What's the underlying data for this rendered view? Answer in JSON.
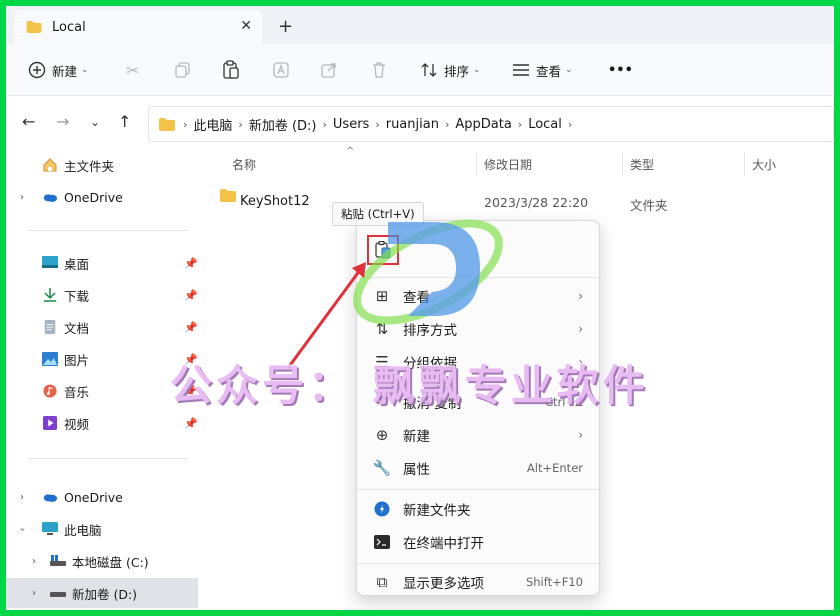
{
  "tab": {
    "title": "Local",
    "close": "✕",
    "new_tab": "+"
  },
  "toolbar": {
    "new_label": "新建",
    "sort_label": "排序",
    "view_label": "查看",
    "more": "•••"
  },
  "address": {
    "crumbs": [
      "此电脑",
      "新加卷 (D:)",
      "Users",
      "ruanjian",
      "AppData",
      "Local"
    ]
  },
  "sidebar": {
    "items": [
      {
        "label": "主文件夹"
      },
      {
        "label": "OneDrive"
      },
      {
        "label": "桌面"
      },
      {
        "label": "下载"
      },
      {
        "label": "文档"
      },
      {
        "label": "图片"
      },
      {
        "label": "音乐"
      },
      {
        "label": "视频"
      },
      {
        "label": "OneDrive"
      },
      {
        "label": "此电脑"
      },
      {
        "label": "本地磁盘 (C:)"
      },
      {
        "label": "新加卷 (D:)"
      }
    ]
  },
  "columns": {
    "name": "名称",
    "modified": "修改日期",
    "type": "类型",
    "size": "大小"
  },
  "files": [
    {
      "name": "KeyShot12",
      "modified": "2023/3/28 22:20",
      "type": "文件夹"
    }
  ],
  "tooltip": {
    "text": "粘贴 (Ctrl+V)"
  },
  "context_menu": {
    "items": [
      {
        "label": "查看",
        "icon": "grid-icon"
      },
      {
        "label": "排序方式",
        "icon": "sort-icon"
      },
      {
        "label": "分组依据",
        "icon": "group-icon"
      },
      {
        "label": "撤消 复制",
        "shortcut": "Ctrl+Z",
        "icon": "undo-icon"
      },
      {
        "label": "新建",
        "icon": "plus-circle-icon"
      },
      {
        "label": "属性",
        "shortcut": "Alt+Enter",
        "icon": "wrench-icon"
      },
      {
        "label": "新建文件夹",
        "icon": "new-folder-icon"
      },
      {
        "label": "在终端中打开",
        "icon": "terminal-icon"
      },
      {
        "label": "显示更多选项",
        "shortcut": "Shift+F10",
        "icon": "open-more-icon"
      }
    ]
  },
  "watermark": {
    "text": "公众号： 飘飘专业软件"
  },
  "colors": {
    "border_green": "#00d646",
    "highlight_red": "#e0303a",
    "watermark_purple": "#e6b6f2"
  }
}
